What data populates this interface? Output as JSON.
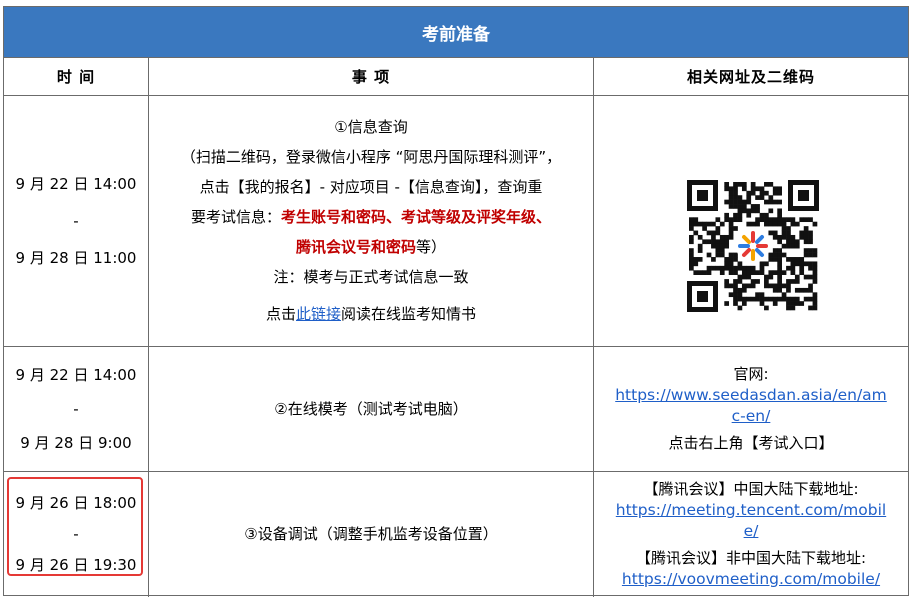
{
  "banner": {
    "title": "考前准备"
  },
  "headers": {
    "time": "时 间",
    "item": "事 项",
    "links": "相关网址及二维码"
  },
  "rows": [
    {
      "time_start": "9 月 22 日 14:00",
      "time_sep": "-",
      "time_end": "9 月 28 日 11:00",
      "item_title": "①信息查询",
      "item_line1": "（扫描二维码，登录微信小程序 “阿思丹国际理科测评”，",
      "item_line2": "点击【我的报名】- 对应项目 -【信息查询】，查询重",
      "item_line3_pre": "要考试信息：",
      "item_line3_red": "考生账号和密码、考试等级及评奖年级、",
      "item_line4_red": "腾讯会议号和密码",
      "item_line4_post": "等）",
      "item_note": "注：模考与正式考试信息一致",
      "item_link_pre": "点击",
      "item_link": "此链接",
      "item_link_post": "阅读在线监考知情书",
      "qr_icon": "qr-code-icon"
    },
    {
      "time_start": "9 月 22 日 14:00",
      "time_sep": "-",
      "time_end": "9 月 28 日 9:00",
      "item_title": "②在线模考（测试考试电脑）",
      "site_label": "官网:",
      "site_url_1": "https://www.seedasdan.asia/en/am",
      "site_url_2": "c-en/",
      "site_note": "点击右上角【考试入口】"
    },
    {
      "time_start": "9 月 26 日 18:00",
      "time_sep": "-",
      "time_end": "9 月 26 日 19:30",
      "item_title": "③设备调试（调整手机监考设备位置）",
      "cn_label": "【腾讯会议】中国大陆下载地址:",
      "cn_url_1": "https://meeting.tencent.com/mobil",
      "cn_url_2": "e/",
      "intl_label": "【腾讯会议】非中国大陆下载地址:",
      "intl_url": "https://voovmeeting.com/mobile/"
    }
  ],
  "colors": {
    "banner": "#3a78bf",
    "red_text": "#c00000",
    "link": "#1f5fc8",
    "highlight": "#e53935"
  }
}
